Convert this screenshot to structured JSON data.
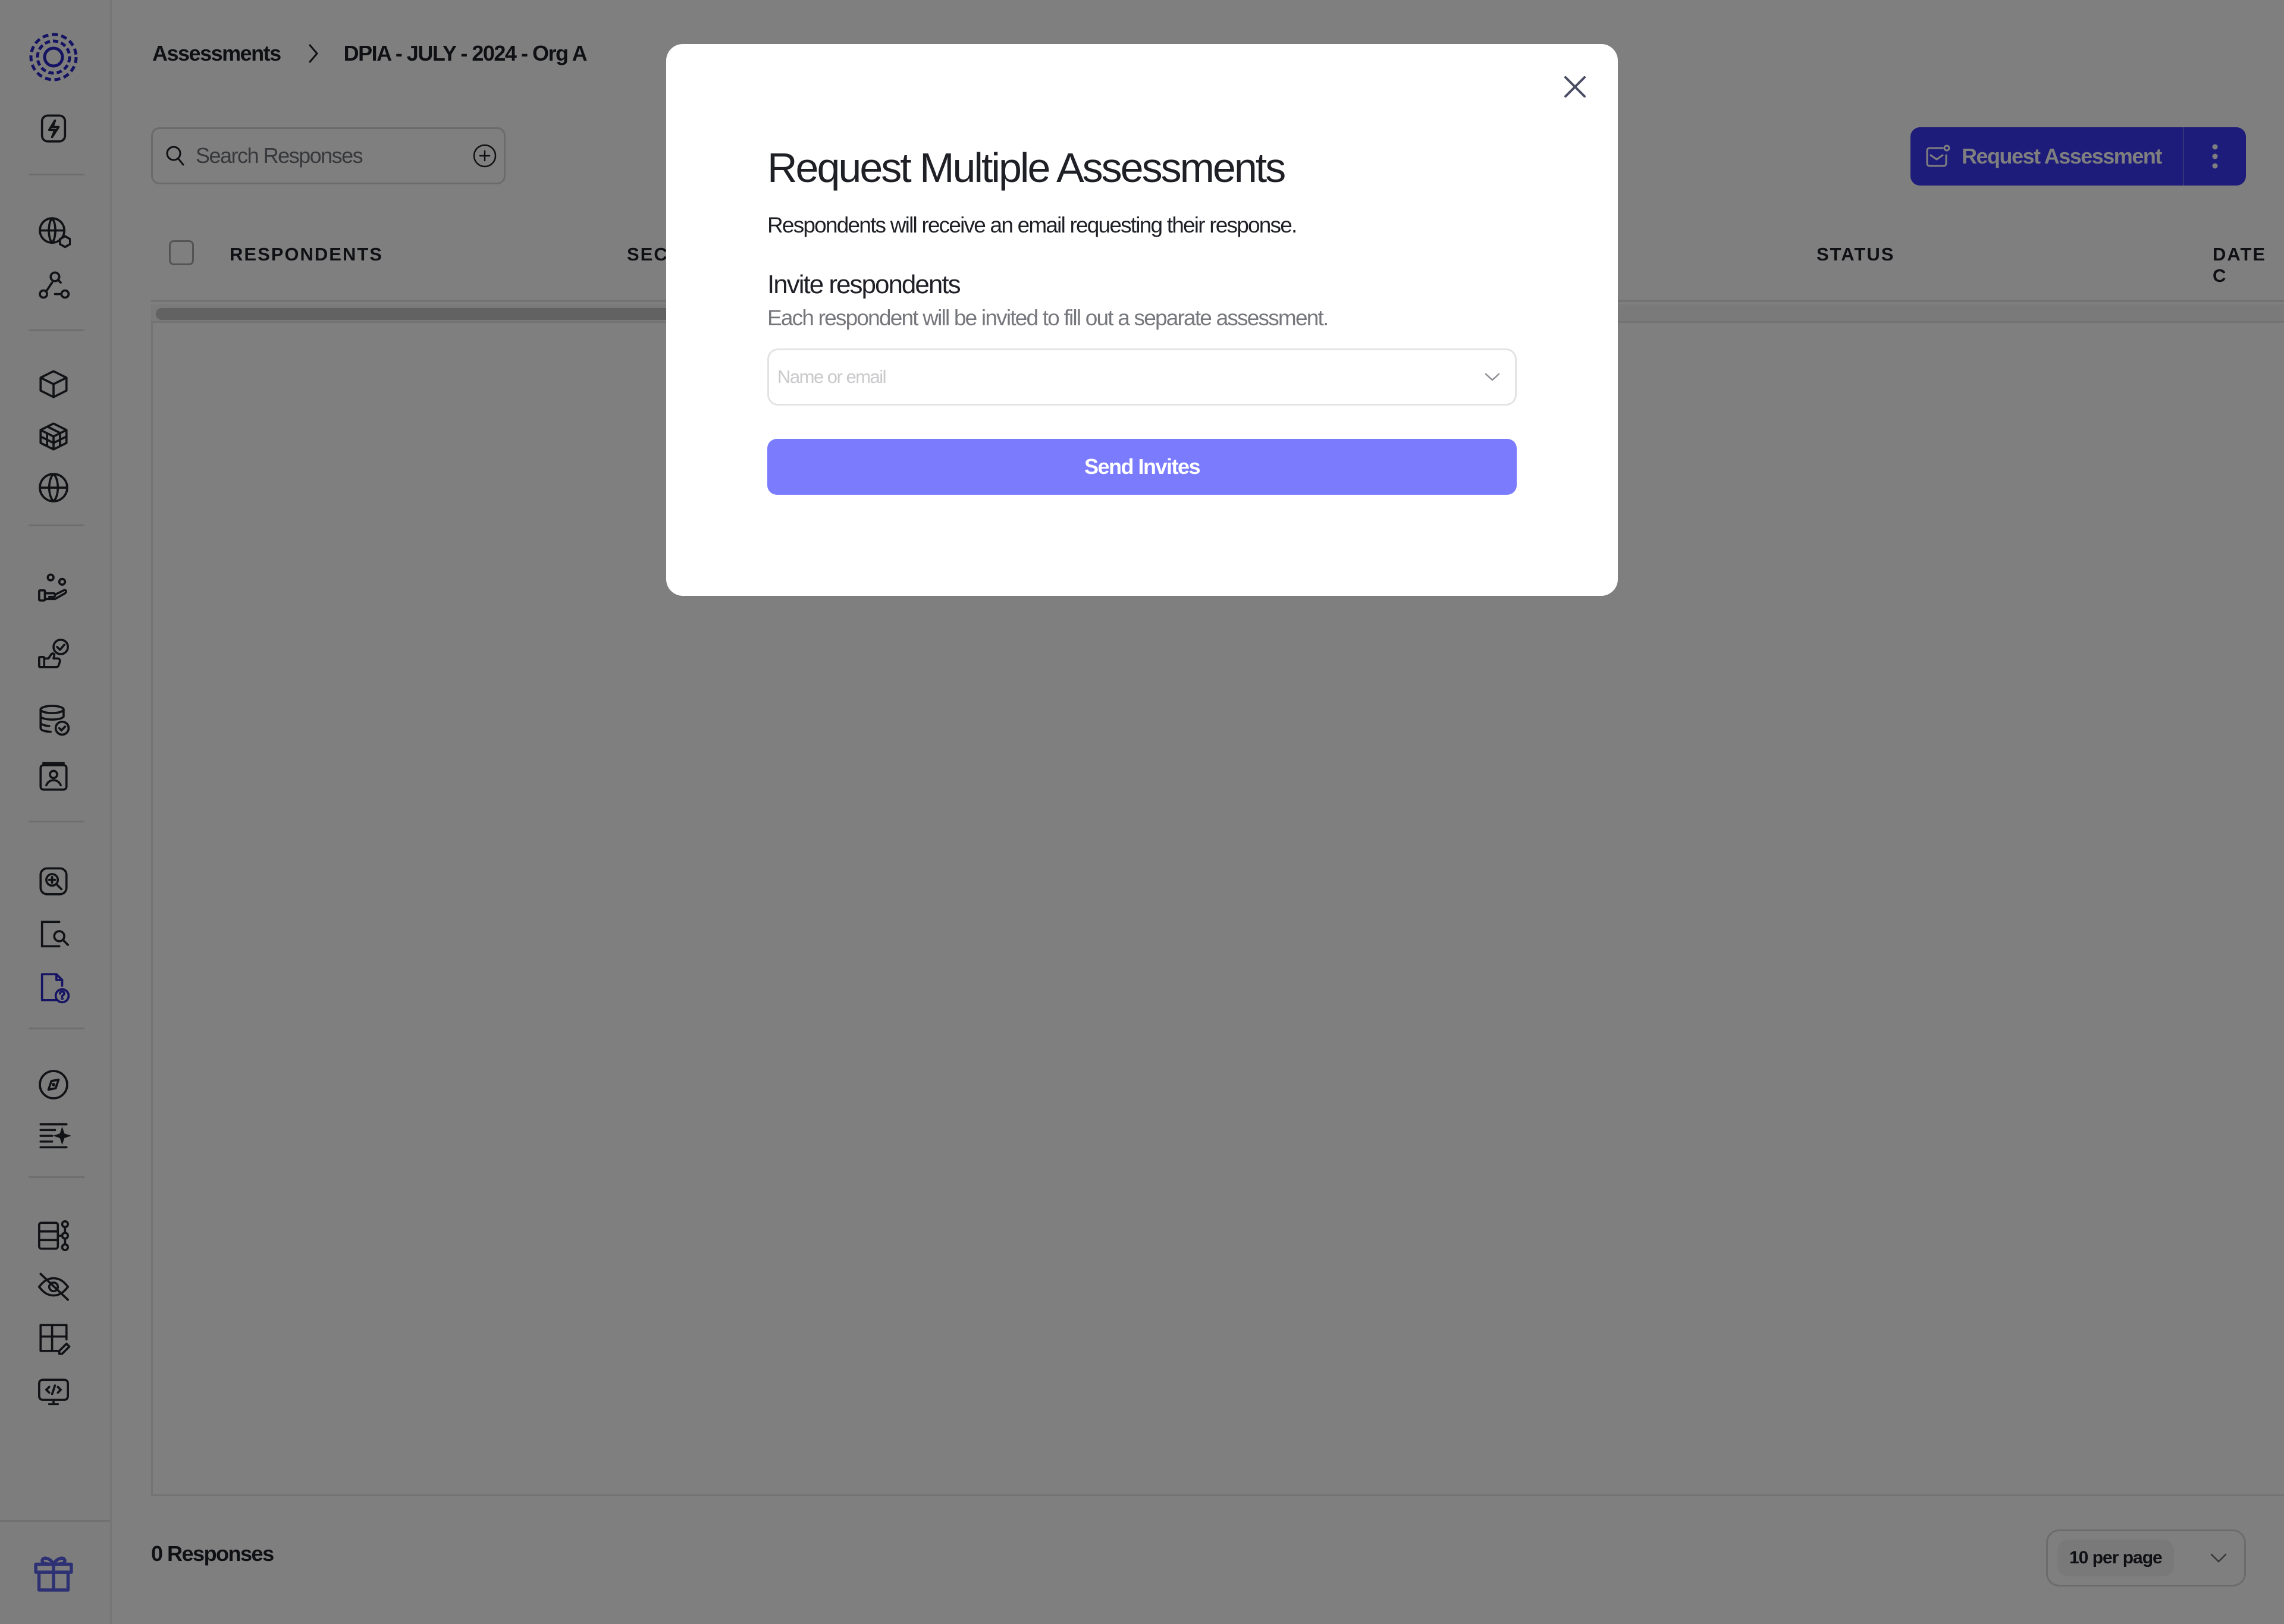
{
  "colors": {
    "brand": "#3b38f5",
    "brand_dark": "#1c1a8c",
    "send_button": "#7a7cfd",
    "active_nav": "#2a27c7",
    "text_primary": "#1f2026",
    "text_muted": "#76777c"
  },
  "sidebar": {
    "logo": "orbit-logo-icon",
    "groups": [
      {
        "items": [
          {
            "icon": "lightning-icon",
            "active": false
          }
        ]
      },
      {
        "items": [
          {
            "icon": "globe-cube-icon",
            "active": false
          },
          {
            "icon": "network-search-icon",
            "active": false
          }
        ]
      },
      {
        "items": [
          {
            "icon": "box-icon",
            "active": false
          },
          {
            "icon": "cubes-icon",
            "active": false
          },
          {
            "icon": "globe-icon",
            "active": false
          }
        ]
      },
      {
        "items": [
          {
            "icon": "hand-people-icon",
            "active": false
          },
          {
            "icon": "thumbs-up-check-icon",
            "active": false
          },
          {
            "icon": "database-check-icon",
            "active": false
          },
          {
            "icon": "contact-card-icon",
            "active": false
          }
        ]
      },
      {
        "items": [
          {
            "icon": "zoom-in-icon",
            "active": false
          },
          {
            "icon": "file-search-icon",
            "active": false
          },
          {
            "icon": "file-question-icon",
            "active": true
          }
        ]
      },
      {
        "items": [
          {
            "icon": "compass-icon",
            "active": false
          },
          {
            "icon": "list-sparkle-icon",
            "active": false
          }
        ]
      },
      {
        "items": [
          {
            "icon": "schema-icon",
            "active": false
          },
          {
            "icon": "eye-off-icon",
            "active": false
          },
          {
            "icon": "layout-edit-icon",
            "active": false
          },
          {
            "icon": "monitor-code-icon",
            "active": false
          }
        ]
      }
    ],
    "footer_icon": "gift-icon"
  },
  "breadcrumb": {
    "items": [
      "Assessments",
      "DPIA - JULY - 2024 - Org A"
    ]
  },
  "search": {
    "placeholder": "Search Responses",
    "value": ""
  },
  "actions": {
    "request_label": "Request Assessment"
  },
  "table": {
    "columns": [
      "RESPONDENTS",
      "SEC",
      "STATUS",
      "DATE C"
    ],
    "rows": []
  },
  "footer": {
    "count_label": "0 Responses",
    "per_page": "10 per page"
  },
  "modal": {
    "title": "Request Multiple Assessments",
    "description": "Respondents will receive an email requesting their response.",
    "field_label": "Invite respondents",
    "field_hint": "Each respondent will be invited to fill out a separate assessment.",
    "input_placeholder": "Name or email",
    "input_value": "",
    "submit_label": "Send Invites"
  }
}
